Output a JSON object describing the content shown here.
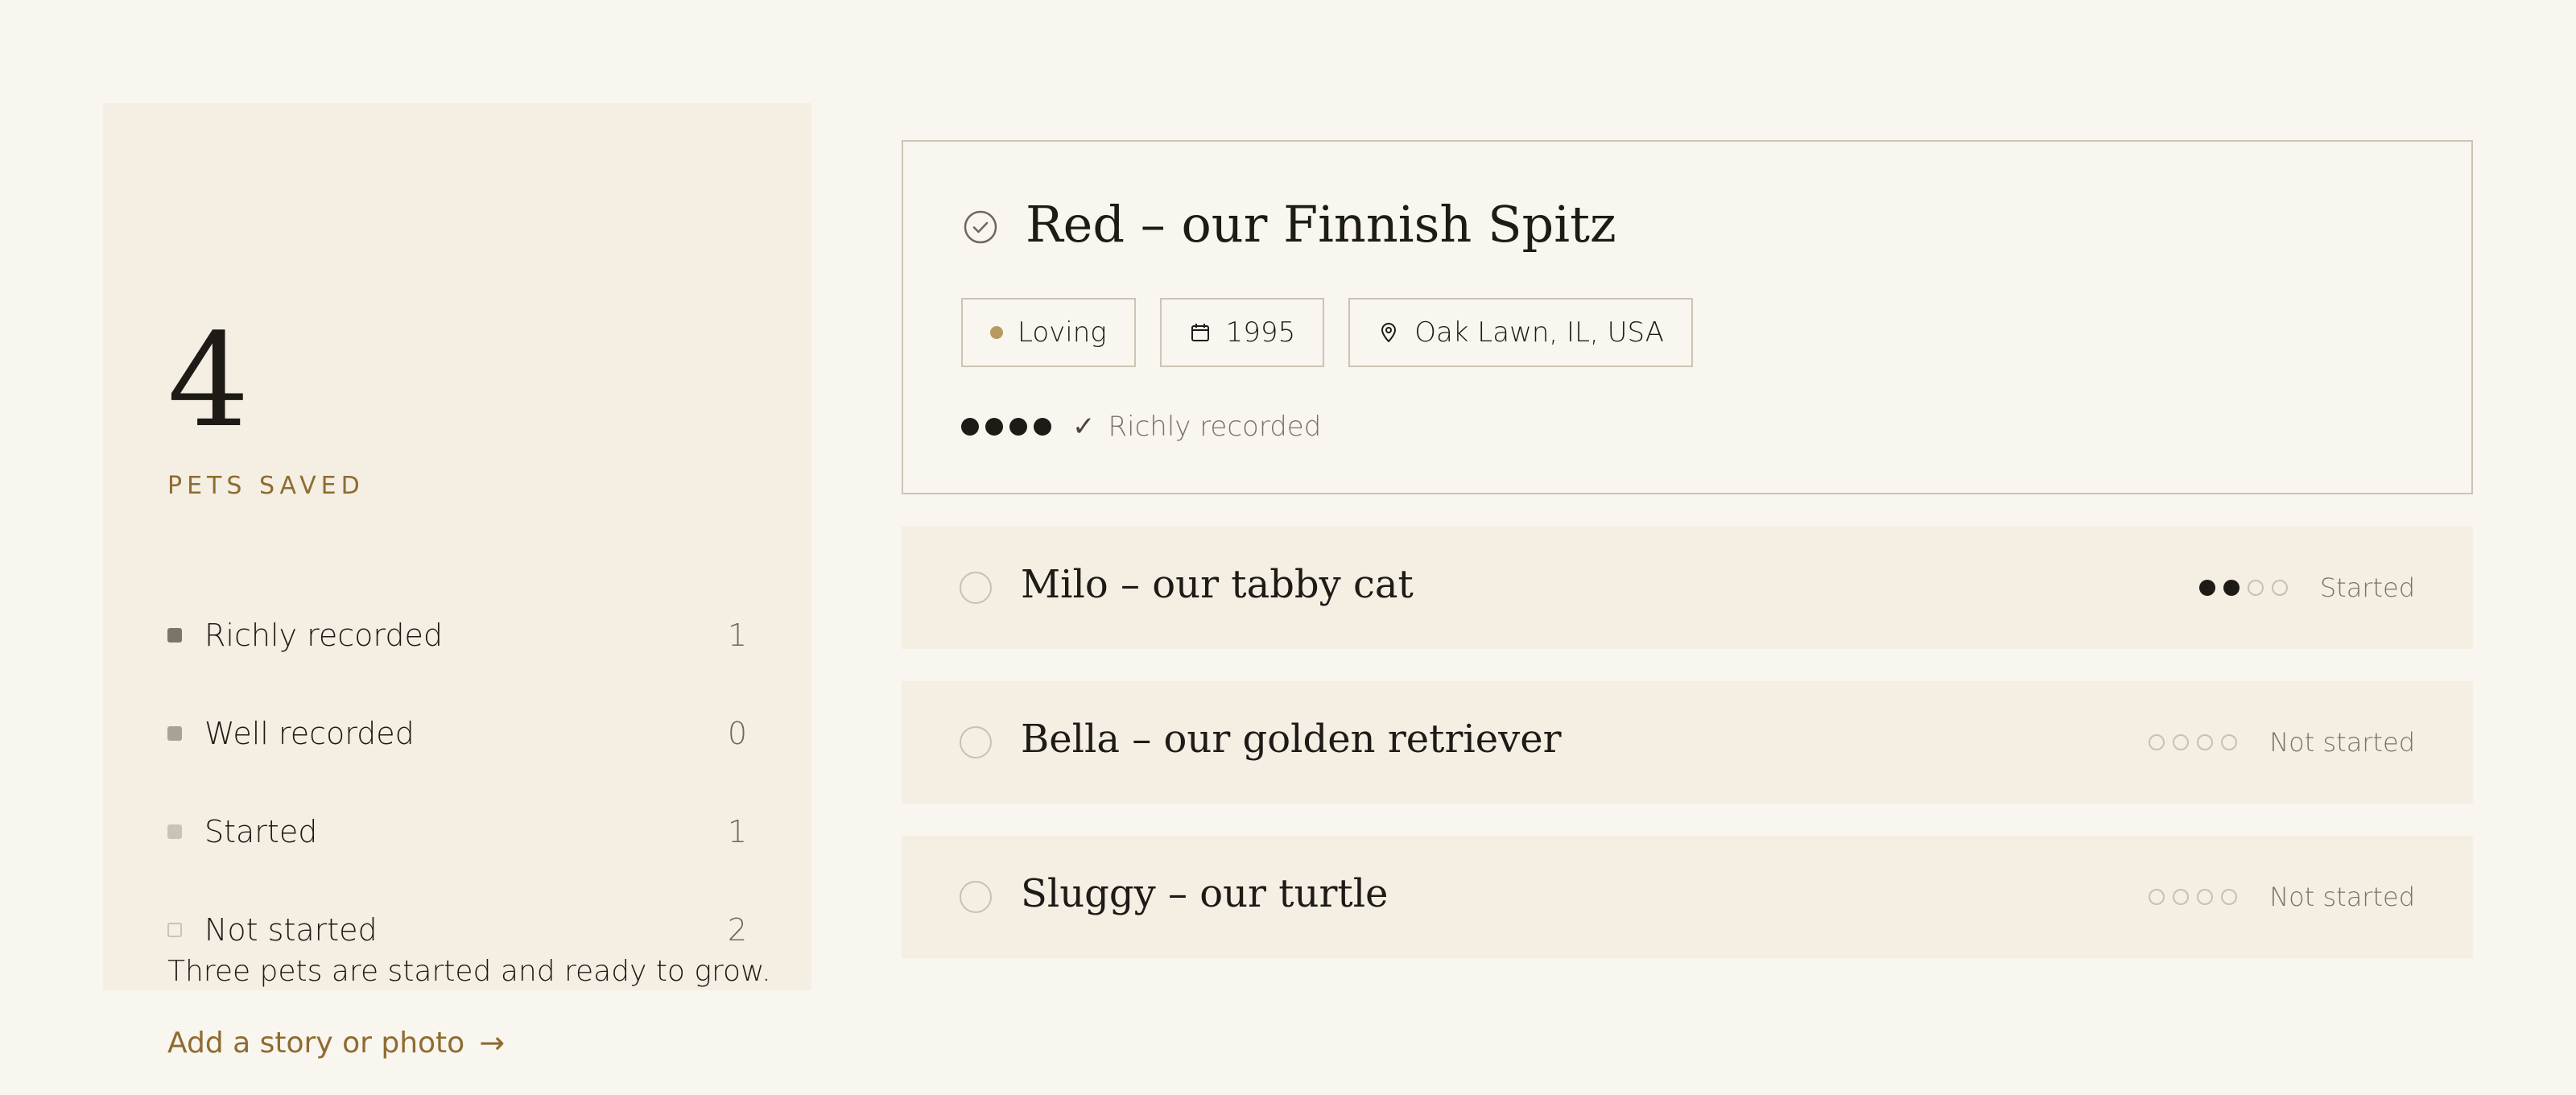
{
  "summary": {
    "count": "4",
    "count_label": "PETS SAVED",
    "legend": [
      {
        "label": "Richly recorded",
        "count": "1",
        "color": "#7a746c",
        "style": "filled"
      },
      {
        "label": "Well recorded",
        "count": "0",
        "color": "#a7a198",
        "style": "filled"
      },
      {
        "label": "Started",
        "count": "1",
        "color": "#c9c2b6",
        "style": "filled"
      },
      {
        "label": "Not started",
        "count": "2",
        "color": "#c9c2b6",
        "style": "outline"
      }
    ],
    "note": "Three pets are started and ready to grow.",
    "add_link": "Add a story or photo",
    "arrow_icon": "arrow-right-icon"
  },
  "pets": {
    "featured": {
      "name": "Red – our Finnish Spitz",
      "icon": "check-circle-icon",
      "chips": [
        {
          "label": "Loving",
          "icon": "dot-icon"
        },
        {
          "label": "1995",
          "icon": "calendar-icon"
        },
        {
          "label": "Oak Lawn, IL, USA",
          "icon": "map-pin-icon"
        }
      ],
      "progress": 4,
      "progress_total": 4,
      "status": "Richly recorded"
    },
    "list": [
      {
        "name": "Milo – our tabby cat",
        "progress": 2,
        "progress_total": 4,
        "status": "Started"
      },
      {
        "name": "Bella – our golden retriever",
        "progress": 0,
        "progress_total": 4,
        "status": "Not started"
      },
      {
        "name": "Sluggy – our turtle",
        "progress": 0,
        "progress_total": 4,
        "status": "Not started"
      }
    ]
  },
  "colors": {
    "background": "#f9f5ef",
    "card": "#f4eee3",
    "accent": "#8e6c30",
    "text": "#1e1a16",
    "muted": "#7a7269"
  }
}
